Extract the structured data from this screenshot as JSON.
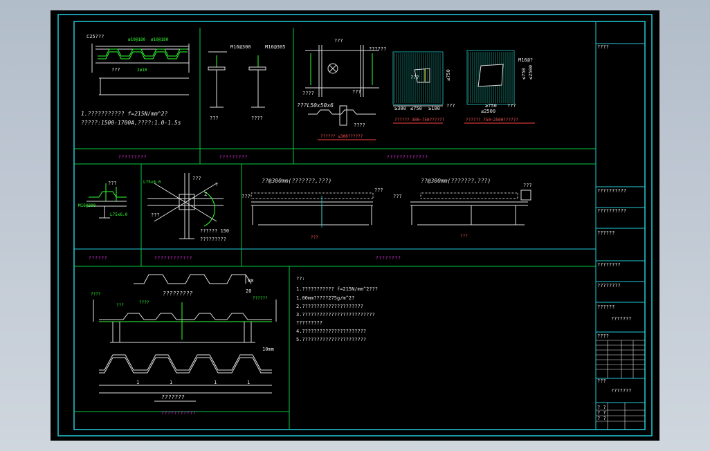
{
  "top": {
    "slab_label": "C25???",
    "bar_top": "ø10@180",
    "bar_top2": "ø10@180",
    "slab_note1": "???",
    "slab_note2": "2ø10",
    "stud_label1": "M16@300",
    "stud_label2": "M16@305",
    "stud_cap1": "???",
    "stud_cap2": "????",
    "spec1": "1.??????????? f=215N/mm^2?",
    "spec2": "?????:1500-1700A,????:1.0-1.5s",
    "opening_labels": [
      "???",
      "??????",
      "????",
      "???",
      "???L50x50x6",
      "????"
    ],
    "caption_small": "??????  ≤300??????",
    "dims_left": [
      "≥300",
      "≤750",
      "≥100"
    ],
    "dims_left_v": "≤750",
    "dims_right": [
      "≥750",
      "≤2500"
    ],
    "dims_right_v": "≤750",
    "dims_right_v2": "≤2500",
    "open_tags": [
      "???",
      "???",
      "M16@?",
      "???"
    ],
    "cap_left": "??????  300~750??????",
    "cap_right": "??????  750~2500??????"
  },
  "middle": {
    "edge_labels": [
      "???",
      "M16@300",
      "L75x6.0"
    ],
    "joint_labels": [
      "L75x6.0",
      "???",
      "?",
      "Z",
      "???",
      "??????  150",
      "?????????"
    ],
    "span1_top": "??@300mm(???????,???)",
    "span1_left": "???",
    "span1_right": "???",
    "span1_cap": "???",
    "span2_top": "??@300mm(???????,???)",
    "span2_left": "???",
    "span2_right": "???",
    "span2_cap": "???"
  },
  "bottom": {
    "profile_h": "80",
    "profile_w": "20",
    "profile_cap": "?????????",
    "sec_tags": [
      "????",
      "???",
      "????"
    ],
    "sec_tag_right": "??????",
    "dim_bottom": [
      "1",
      "1",
      "1",
      "1"
    ],
    "dim_tag": "10mm",
    "bottom_cap": "???????",
    "notes_title": "??:",
    "notes": [
      "1.??????????? f=215N/mm^2???",
      "1.00mm?????275g/m^2?",
      "2.?????????????????????",
      "3.?????????????????????????",
      "?????????",
      "4.??????????????????????",
      "5.??????????????????????"
    ]
  },
  "panel_titles": [
    "?????????",
    "?????????",
    "?????????????"
  ],
  "panel_titles2": [
    "??????",
    "????????????",
    "????????"
  ],
  "panel_title3": "???????????",
  "title_block": [
    "????",
    "??????????",
    "??????????",
    "??????",
    "????????",
    "????????",
    "??????",
    "???????",
    "????",
    "???",
    "???????",
    "? ?",
    "? ?",
    "? ?"
  ]
}
